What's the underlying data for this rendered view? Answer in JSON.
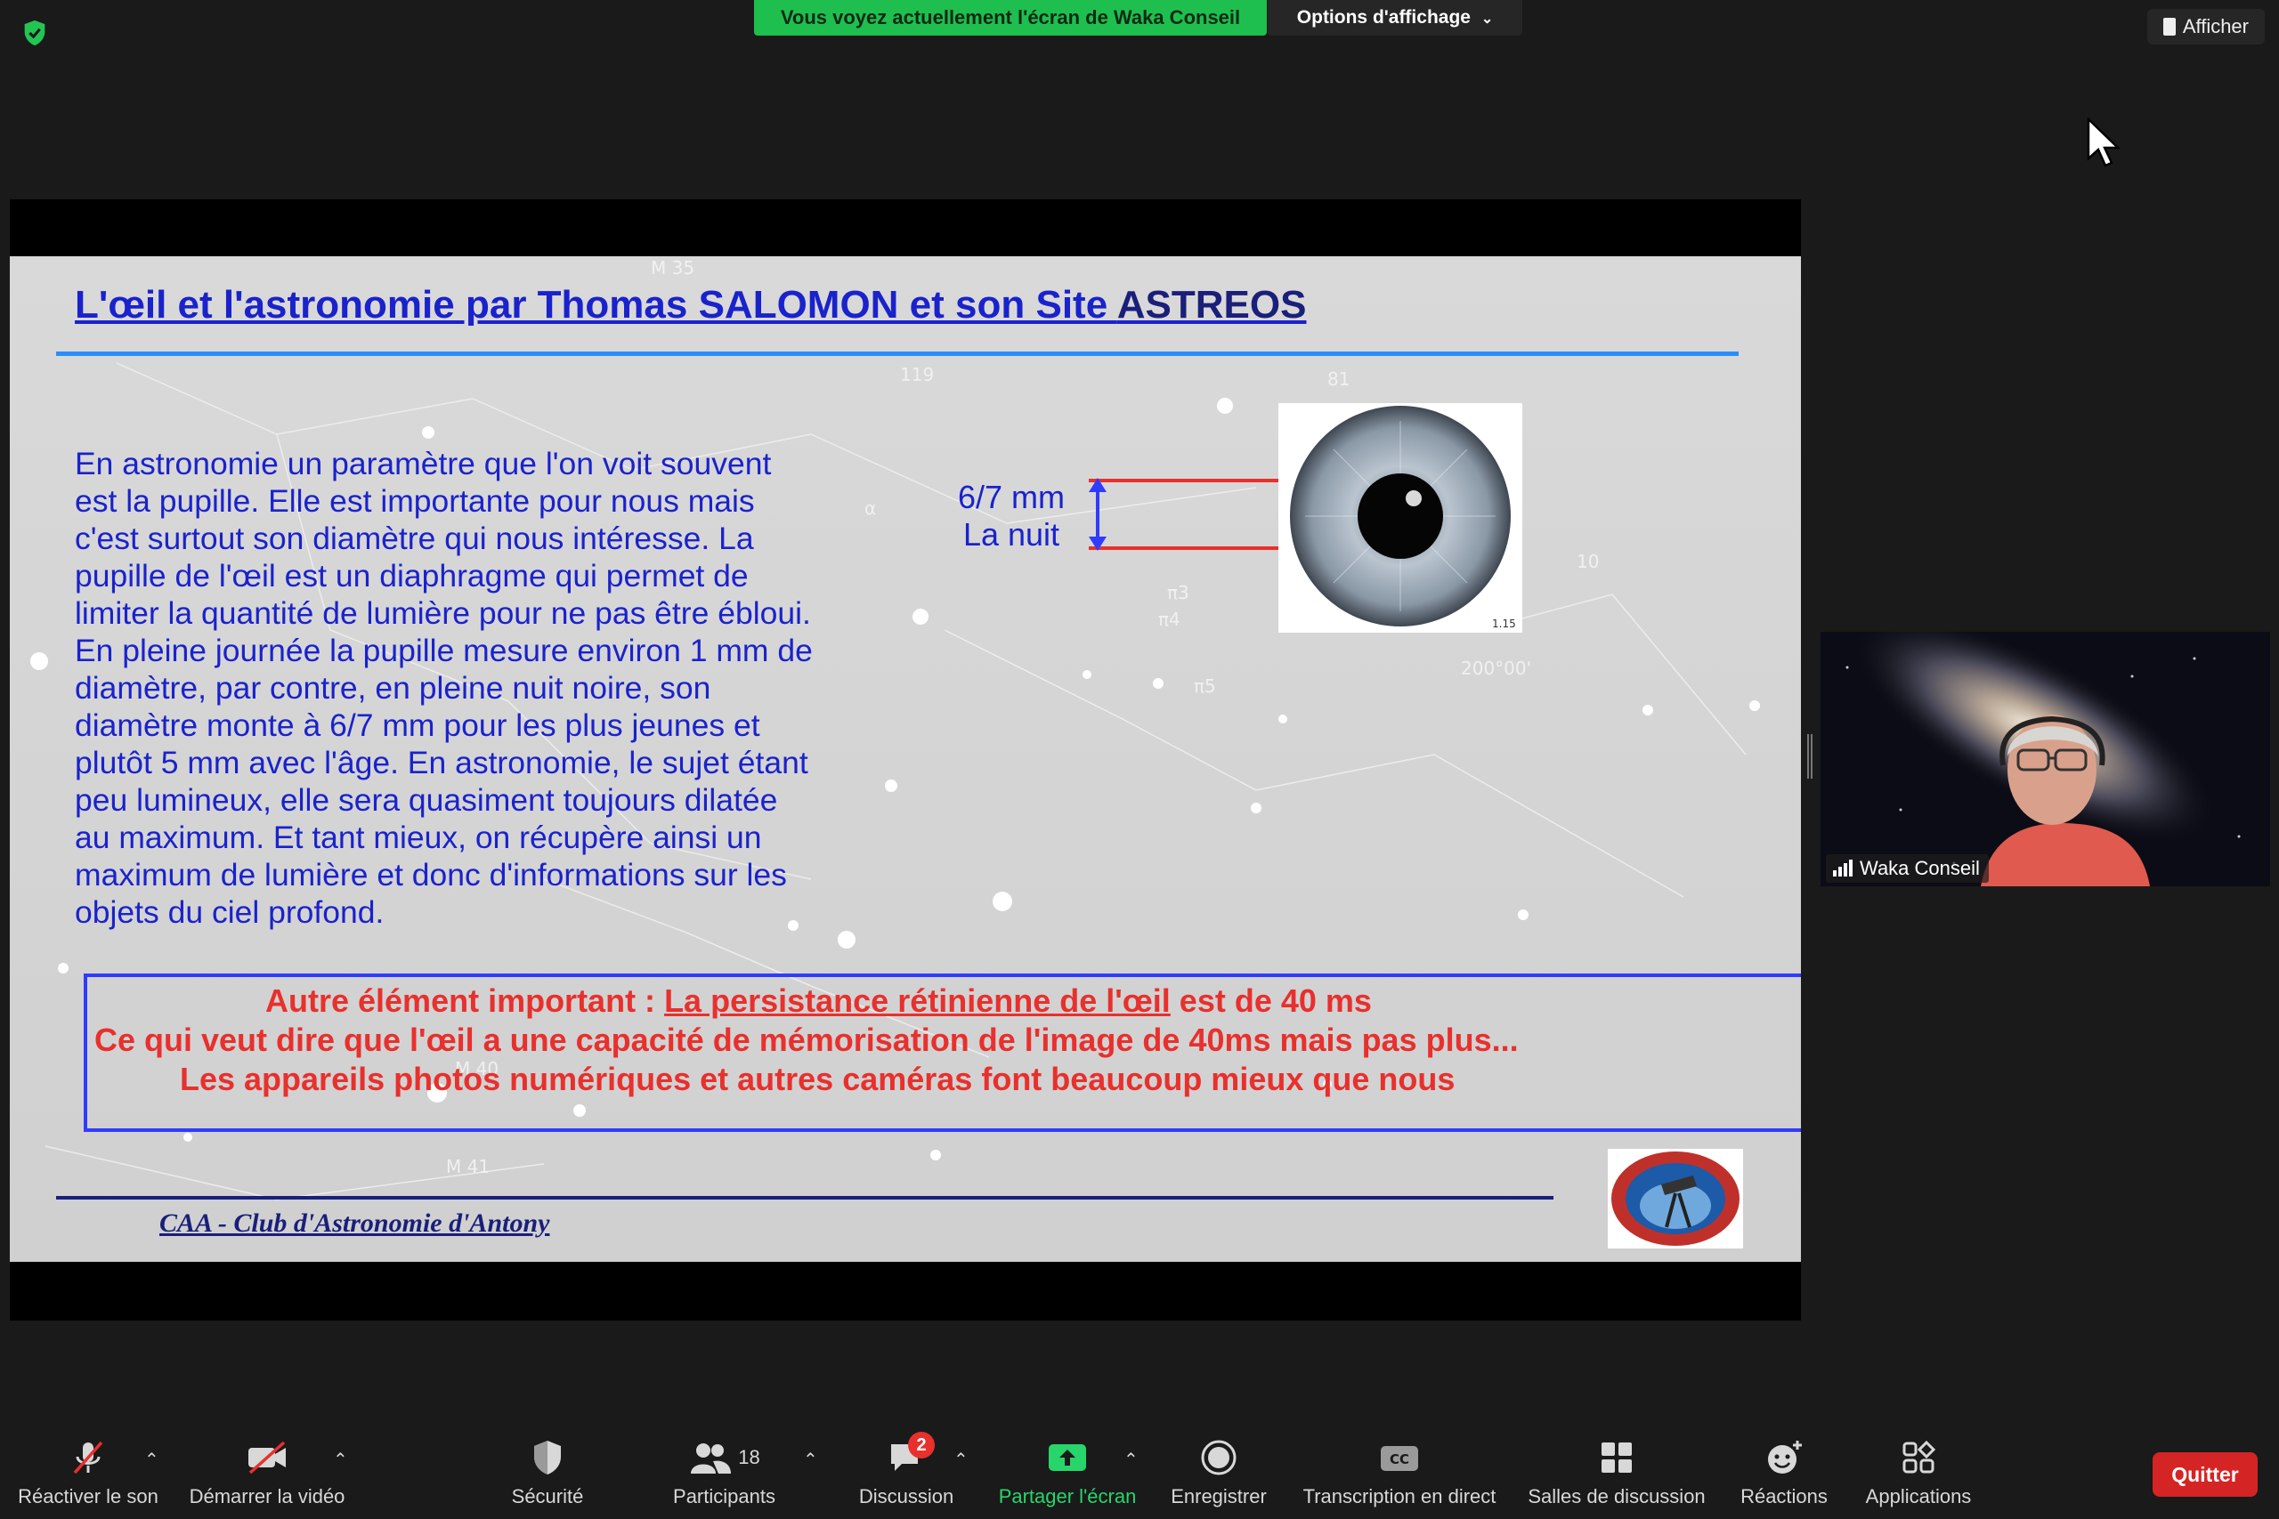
{
  "top": {
    "share_banner": "Vous voyez actuellement l'écran de Waka Conseil",
    "view_options": "Options d'affichage",
    "afficher": "Afficher"
  },
  "slide": {
    "title_main": "L'œil et l'astronomie par Thomas SALOMON et son Site ",
    "title_brand": "ASTREOS",
    "body": "En astronomie un paramètre que l'on voit souvent est la pupille. Elle est importante pour nous mais c'est surtout son diamètre qui nous intéresse. La pupille de l'œil est un diaphragme qui permet de limiter la quantité de lumière pour ne pas être ébloui. En pleine journée la pupille mesure environ 1 mm de diamètre, par contre, en pleine nuit noire, son diamètre monte à 6/7 mm pour les plus jeunes et plutôt 5 mm avec l'âge. En astronomie, le sujet étant peu lumineux, elle sera quasiment toujours dilatée au maximum. Et tant mieux, on récupère ainsi un maximum de lumière et donc d'informations sur les objets du ciel profond.",
    "body_lines": [
      "En astronomie un paramètre que l'on voit souvent",
      "est la pupille. Elle est importante pour nous mais",
      "c'est surtout son diamètre qui nous intéresse. La",
      "pupille de l'œil est un diaphragme qui permet de",
      "limiter la quantité de lumière pour ne pas être ébloui.",
      "En pleine journée la pupille mesure environ 1 mm de",
      "diamètre, par contre, en pleine nuit noire, son",
      "diamètre monte à 6/7 mm pour les plus jeunes et",
      "plutôt 5 mm avec l'âge. En astronomie, le sujet étant",
      "peu lumineux, elle sera quasiment toujours dilatée",
      "au maximum. Et tant mieux, on récupère ainsi un",
      "maximum de lumière et donc d'informations sur les",
      "objets du ciel profond."
    ],
    "mm_label_1": "6/7 mm",
    "mm_label_2": "La nuit",
    "eye_caption": "1.15",
    "note_line1_prefix": "Autre élément important : ",
    "note_line1_link": "La persistance rétinienne de l'œil",
    "note_line1_suffix": " est de 40 ms",
    "note_line2": "Ce qui veut dire que l'œil a une capacité de mémorisation de l'image  de 40ms mais pas plus...",
    "note_line3": "Les appareils photos numériques et autres caméras font beaucoup mieux que nous",
    "footer": "CAA - Club d'Astronomie d'Antony"
  },
  "video": {
    "name": "Waka Conseil"
  },
  "toolbar": {
    "unmute": "Réactiver le son",
    "start_video": "Démarrer la vidéo",
    "security": "Sécurité",
    "participants": "Participants",
    "participants_count": "18",
    "chat": "Discussion",
    "chat_badge": "2",
    "share": "Partager l'écran",
    "record": "Enregistrer",
    "transcript": "Transcription en direct",
    "rooms": "Salles de discussion",
    "reactions": "Réactions",
    "apps": "Applications",
    "quit": "Quitter"
  },
  "colors": {
    "share_green": "#1fbf4f",
    "slide_blue_text": "#1a22cc",
    "slide_red_text": "#e8302d",
    "quit_red": "#d52424"
  }
}
